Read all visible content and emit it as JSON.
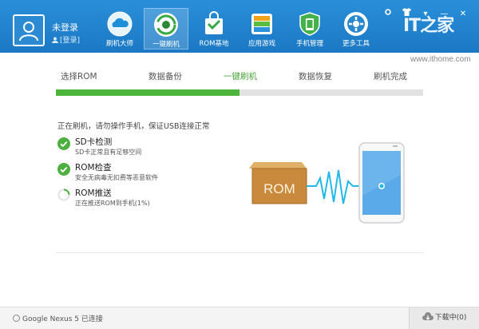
{
  "user": {
    "name": "未登录",
    "login_link": "[登录]"
  },
  "nav": [
    {
      "label": "刷机大师",
      "icon": "cloud-icon"
    },
    {
      "label": "一键刷机",
      "icon": "one-click-flash-icon",
      "active": true
    },
    {
      "label": "ROM基地",
      "icon": "rom-bag-icon"
    },
    {
      "label": "应用游戏",
      "icon": "apps-icon"
    },
    {
      "label": "手机管理",
      "icon": "phone-shield-icon"
    },
    {
      "label": "更多工具",
      "icon": "more-tools-icon"
    }
  ],
  "window_controls": {
    "settings": "gear-icon",
    "skin": "shirt-icon",
    "menu": "▾",
    "minimize": "—",
    "close": "✕"
  },
  "brand": {
    "logo": "IT之家",
    "url": "www.ithome.com"
  },
  "steps": [
    "选择ROM",
    "数据备份",
    "一键刷机",
    "数据恢复",
    "刷机完成"
  ],
  "active_step": 2,
  "progress": 0.5,
  "notice": "正在刷机，请勿操作手机，保证USB连接正常",
  "tasks": [
    {
      "title": "SD卡检测",
      "subtitle": "SD卡正常且有足够空间",
      "status": "done"
    },
    {
      "title": "ROM检查",
      "subtitle": "安全无病毒无扣费等恶意软件",
      "status": "done"
    },
    {
      "title": "ROM推送",
      "subtitle": "正在推送ROM到手机(1%)",
      "status": "in-progress"
    }
  ],
  "illustration": {
    "box_label": "ROM"
  },
  "footer": {
    "device": "Google Nexus 5 已连接",
    "download": "下载中(0)"
  },
  "colors": {
    "header": "#1f82cc",
    "accent_green": "#4db43c",
    "wave": "#22b8e8"
  }
}
